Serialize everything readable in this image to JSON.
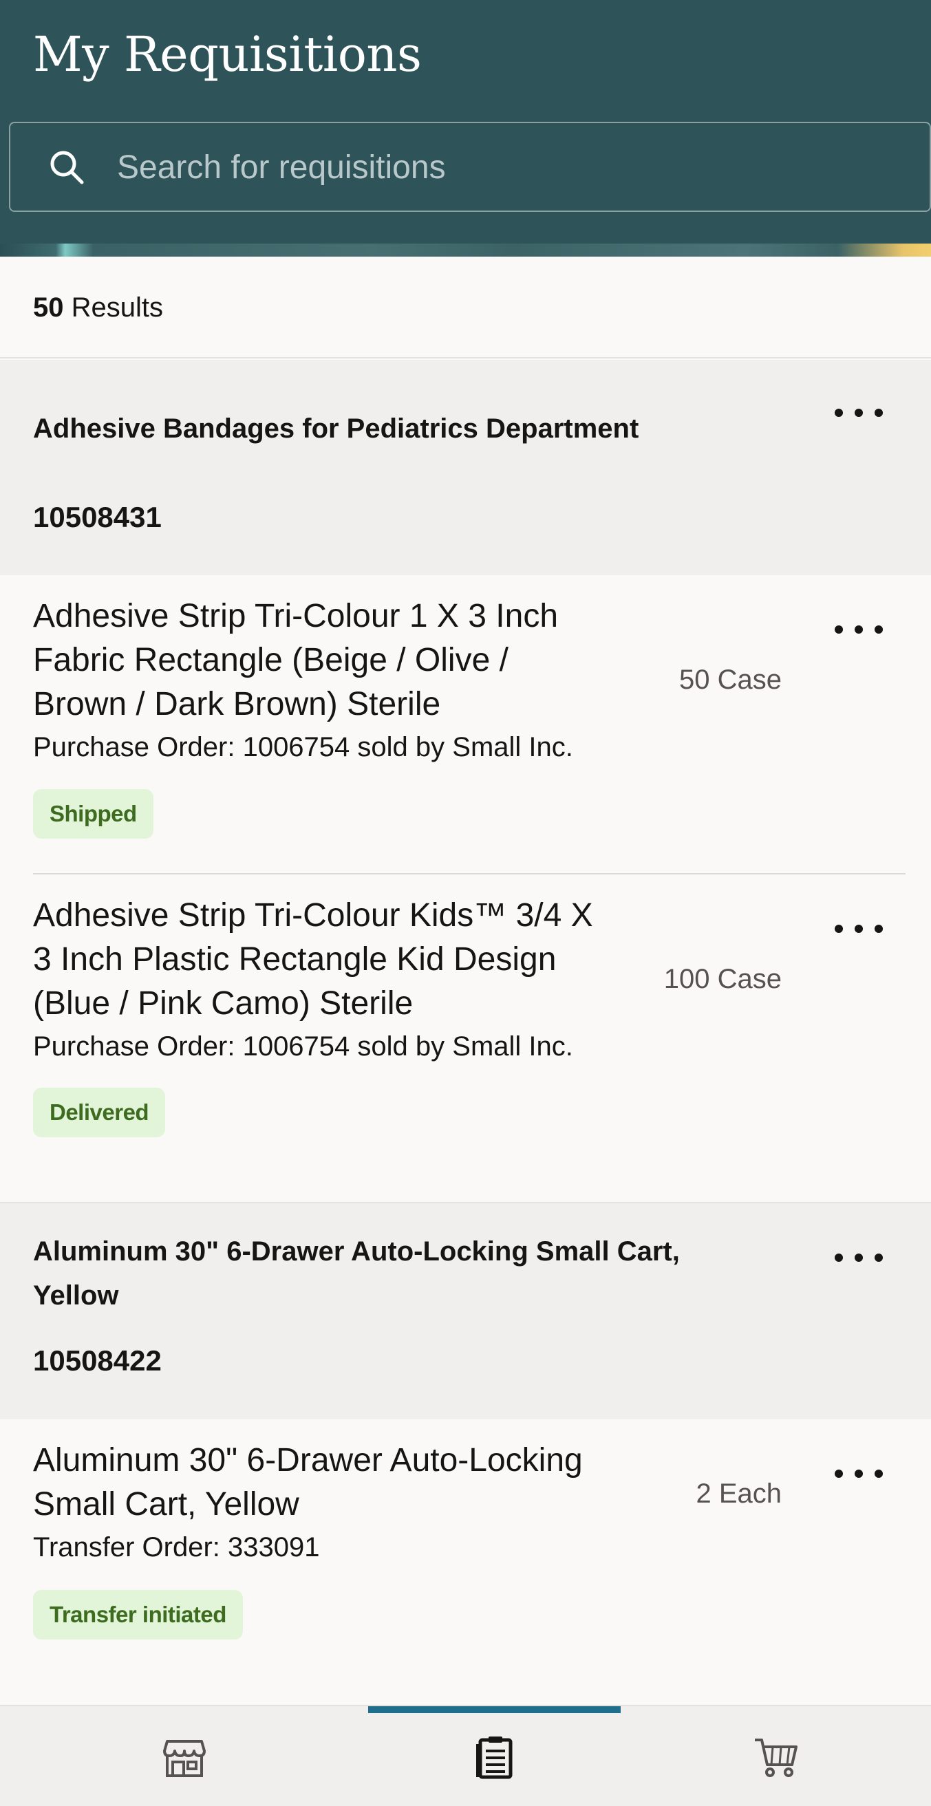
{
  "header": {
    "title": "My Requisitions",
    "search_placeholder": "Search for requisitions"
  },
  "results": {
    "count": "50",
    "label": " Results"
  },
  "groups": [
    {
      "title": "Adhesive Bandages for Pediatrics Department",
      "id": "10508431",
      "lines": [
        {
          "name": "Adhesive Strip Tri-Colour 1 X 3 Inch Fabric Rectangle (Beige / Olive / Brown / Dark Brown) Sterile",
          "quantity": "50 Case",
          "order": "Purchase Order: 1006754 sold by Small Inc.",
          "status": "Shipped"
        },
        {
          "name": "Adhesive Strip Tri-Colour Kids™ 3/4 X 3 Inch Plastic Rectangle Kid Design (Blue / Pink Camo) Sterile",
          "quantity": "100 Case",
          "order": "Purchase Order: 1006754 sold by Small Inc.",
          "status": "Delivered"
        }
      ]
    },
    {
      "title": "Aluminum 30\" 6-Drawer Auto-Locking Small Cart, Yellow",
      "id": "10508422",
      "lines": [
        {
          "name": "Aluminum 30\" 6-Drawer Auto-Locking Small Cart, Yellow",
          "quantity": "2 Each",
          "order": "Transfer Order: 333091",
          "status": "Transfer initiated"
        }
      ]
    }
  ],
  "tabs": [
    {
      "icon": "store-icon",
      "active": false
    },
    {
      "icon": "requisitions-icon",
      "active": true
    },
    {
      "icon": "cart-icon",
      "active": false
    }
  ],
  "colors": {
    "header_bg": "#2e5358",
    "badge_bg": "#e2f5d8",
    "badge_text": "#3d6b1f",
    "active_tab": "#1e6e8c"
  }
}
